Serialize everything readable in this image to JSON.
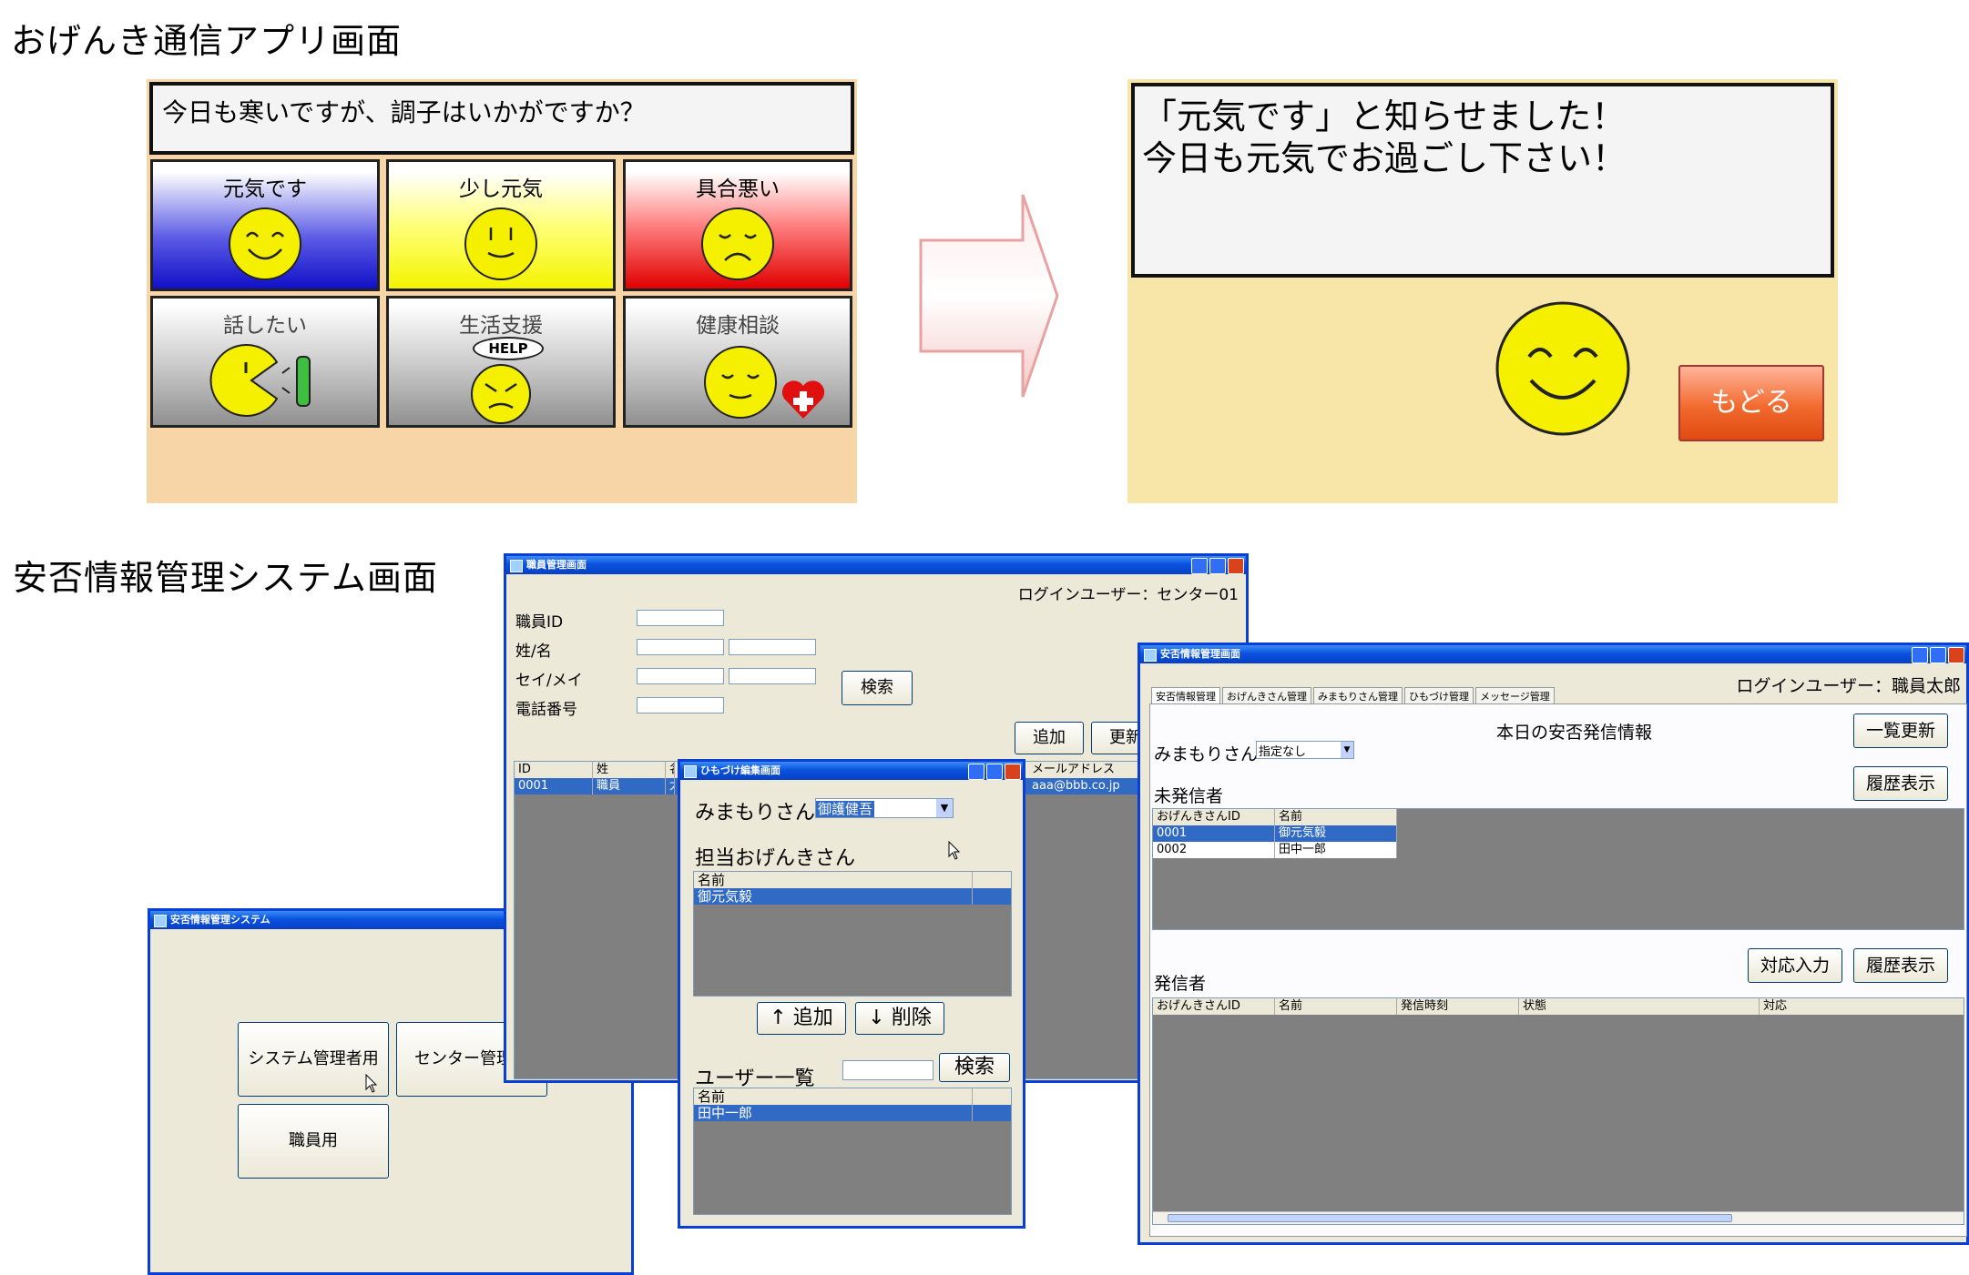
{
  "headings": {
    "app": "おげんき通信アプリ画面",
    "system": "安否情報管理システム画面"
  },
  "app1": {
    "question": "今日も寒いですが、調子はいかがですか？",
    "buttons": [
      "元気です",
      "少し元気",
      "具合悪い",
      "話したい",
      "生活支援",
      "健康相談"
    ],
    "help_label": "HELP"
  },
  "app2": {
    "message_line1": "「元気です」と知らせました！",
    "message_line2": "今日も元気でお過ごし下さい！",
    "back_label": "もどる"
  },
  "colors": {
    "accent_blue": "#0a3fd6",
    "selection": "#316ac5",
    "grid_bg": "#808080"
  },
  "win_login": {
    "title": "安否情報管理システム",
    "btn_system": "システム管理者用",
    "btn_center": "センター管理者",
    "btn_staff": "職員用"
  },
  "win_staff": {
    "title": "職員管理画面",
    "login_user": "ログインユーザー：センター01",
    "label_id": "職員ID",
    "label_name": "姓/名",
    "label_kana": "セイ/メイ",
    "label_phone": "電話番号",
    "search": "検索",
    "add": "追加",
    "update": "更新",
    "cols": [
      "ID",
      "姓",
      "名",
      "メールアドレス"
    ],
    "row": [
      "0001",
      "職員",
      "太",
      "aaa@bbb.co.jp"
    ]
  },
  "win_link": {
    "title": "ひもづけ編集画面",
    "watcher_label": "みまもりさん",
    "watcher_value": "御護健吾",
    "assigned_label": "担当おげんきさん",
    "name_col": "名前",
    "assigned_row": "御元気毅",
    "add_btn": "↑ 追加",
    "del_btn": "↓ 削除",
    "userlist_label": "ユーザー一覧",
    "search": "検索",
    "user_row": "田中一郎"
  },
  "win_main": {
    "title": "安否情報管理画面",
    "tabs": [
      "安否情報管理",
      "おげんきさん管理",
      "みまもりさん管理",
      "ひもづけ管理",
      "メッセージ管理"
    ],
    "login_user": "ログインユーザー：職員太郎",
    "heading": "本日の安否発信情報",
    "refresh": "一覧更新",
    "history": "履歴表示",
    "watcher_label": "みまもりさん",
    "watcher_value": "指定なし",
    "unsent_label": "未発信者",
    "unsent_cols": [
      "おげんきさんID",
      "名前"
    ],
    "unsent_rows": [
      [
        "0001",
        "御元気毅"
      ],
      [
        "0002",
        "田中一郎"
      ]
    ],
    "sent_label": "発信者",
    "respond": "対応入力",
    "history2": "履歴表示",
    "sent_cols": [
      "おげんきさんID",
      "名前",
      "発信時刻",
      "状態",
      "対応"
    ]
  }
}
